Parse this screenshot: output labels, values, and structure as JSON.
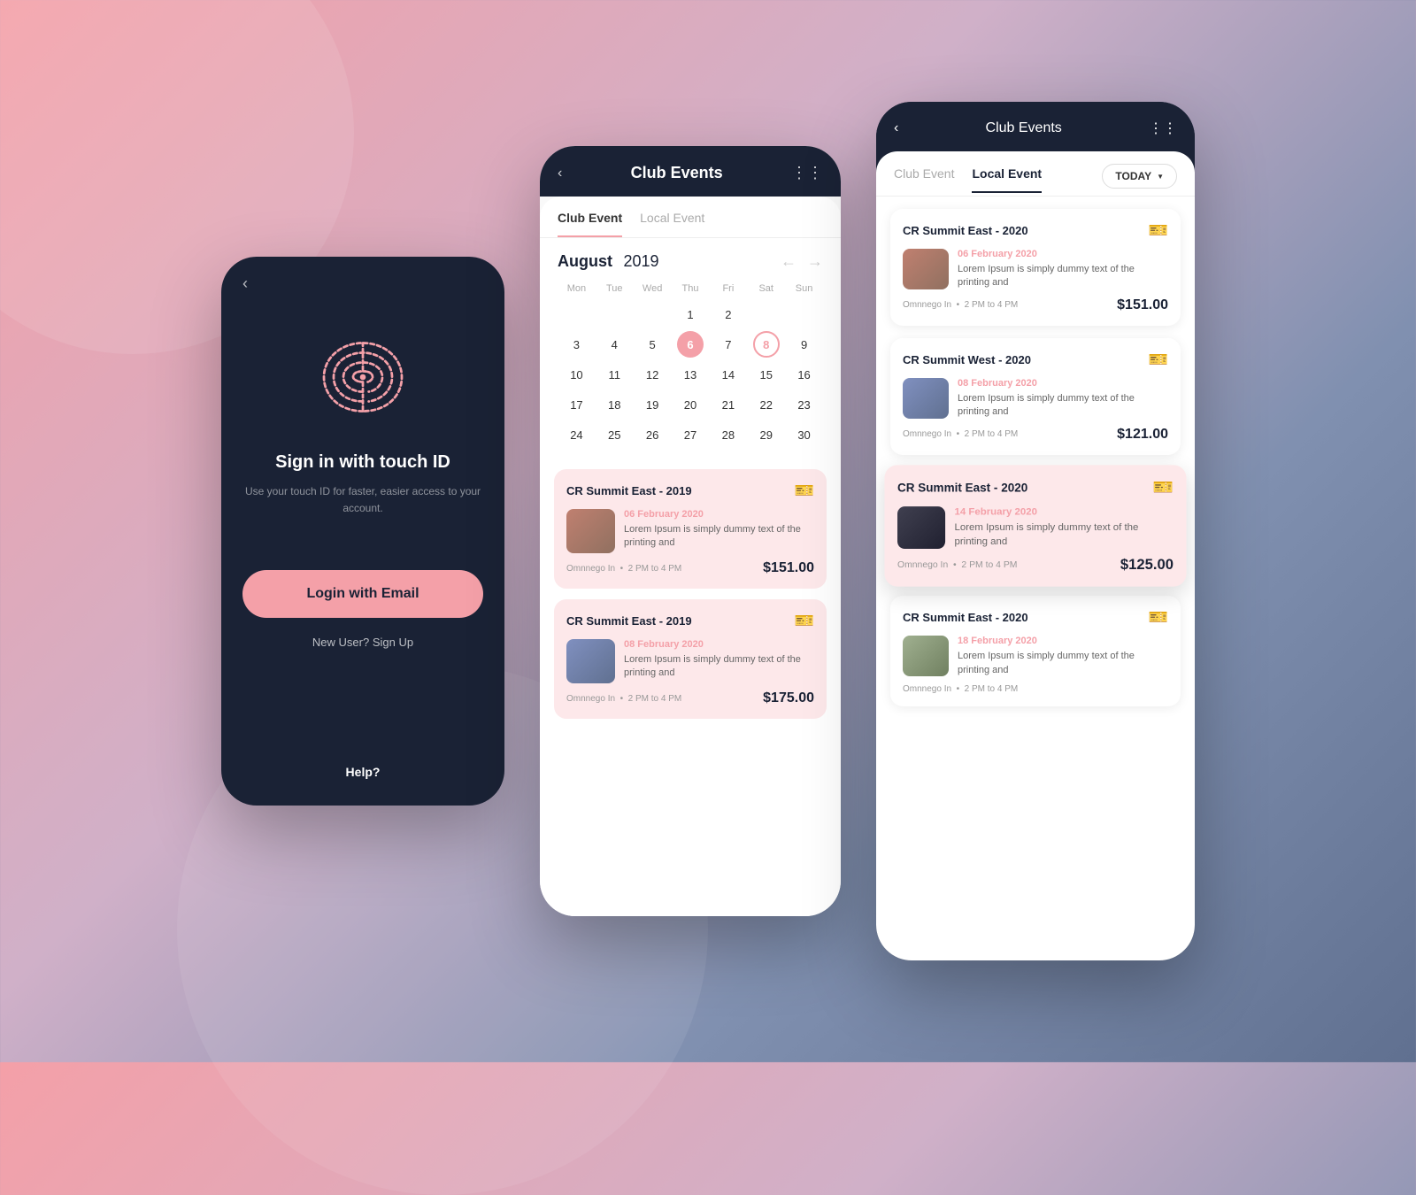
{
  "phone1": {
    "back_label": "‹",
    "sign_in_title": "Sign in with touch ID",
    "sign_in_subtitle": "Use your touch ID for faster, easier\naccess to your account.",
    "login_btn_label": "Login with Email",
    "new_user_label": "New User? Sign Up",
    "help_label": "Help?"
  },
  "phone2": {
    "header": {
      "back_label": "‹",
      "title": "Club Events",
      "dots_label": "⋮⋮"
    },
    "tabs": [
      {
        "label": "Club Event",
        "active": true
      },
      {
        "label": "Local Event",
        "active": false
      }
    ],
    "calendar": {
      "month": "August",
      "year": "2019",
      "day_labels": [
        "Mon",
        "Tue",
        "Wed",
        "Thu",
        "Fri",
        "Sat",
        "Sun"
      ],
      "days": [
        "",
        "",
        "",
        "1",
        "2",
        "3",
        "4",
        "5",
        "6",
        "7",
        "8",
        "9",
        "10",
        "11",
        "12",
        "13",
        "14",
        "15",
        "16",
        "17",
        "18",
        "19",
        "20",
        "21",
        "22",
        "23",
        "24",
        "25",
        "26",
        "27",
        "28",
        "29",
        "30"
      ],
      "highlighted_circle": "6",
      "highlighted_outline": "8"
    },
    "events": [
      {
        "title": "CR Summit East - 2019",
        "date": "06 February 2020",
        "description": "Lorem Ipsum is simply dummy text of the printing and",
        "location": "Omnnego In",
        "time": "2 PM to 4 PM",
        "price": "$151.00"
      },
      {
        "title": "CR Summit East - 2019",
        "date": "08 February 2020",
        "description": "Lorem Ipsum is simply dummy text of the printing and",
        "location": "Omnnego In",
        "time": "2 PM to 4 PM",
        "price": "$175.00"
      }
    ]
  },
  "phone3": {
    "header": {
      "back_label": "‹",
      "title": "Club Events",
      "dots_label": "⋮⋮"
    },
    "tabs": [
      {
        "label": "Club Event",
        "active": false
      },
      {
        "label": "Local Event",
        "active": true
      }
    ],
    "today_label": "TODAY",
    "events": [
      {
        "title": "CR Summit East - 2020",
        "date": "06 February 2020",
        "description": "Lorem Ipsum is simply dummy text of the printing and",
        "location": "Omnnego In",
        "time": "2 PM to 4 PM",
        "price": "$151.00",
        "highlighted": false
      },
      {
        "title": "CR Summit West - 2020",
        "date": "08 February 2020",
        "description": "Lorem Ipsum is simply dummy text of the printing and",
        "location": "Omnnego In",
        "time": "2 PM to 4 PM",
        "price": "$121.00",
        "highlighted": false
      },
      {
        "title": "CR Summit East - 2020",
        "date": "14 February 2020",
        "description": "Lorem Ipsum is simply dummy text of the printing and",
        "location": "Omnnego In",
        "time": "2 PM to 4 PM",
        "price": "$125.00",
        "highlighted": true
      },
      {
        "title": "CR Summit East - 2020",
        "date": "18 February 2020",
        "description": "Lorem Ipsum is simply dummy text of the printing and",
        "location": "Omnnego In",
        "time": "2 PM to 4 PM",
        "price": "",
        "highlighted": false
      }
    ]
  }
}
